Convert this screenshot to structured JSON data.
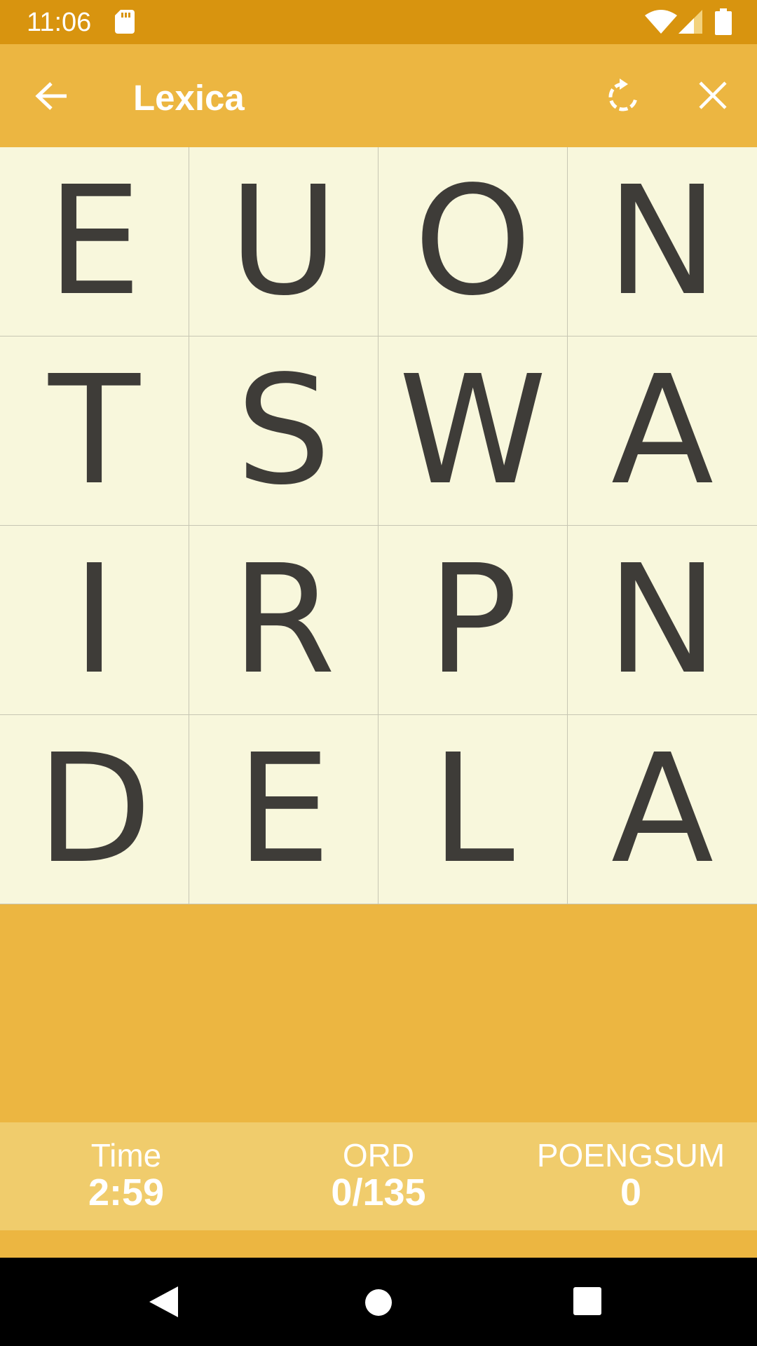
{
  "status_bar": {
    "time": "11:06",
    "icons": [
      "sd-card-icon",
      "wifi-icon",
      "cell-signal-icon",
      "battery-icon"
    ]
  },
  "app_bar": {
    "title": "Lexica",
    "icons": [
      "back-arrow-icon",
      "restart-icon",
      "close-icon"
    ]
  },
  "board": {
    "letters": [
      "E",
      "U",
      "O",
      "N",
      "T",
      "S",
      "W",
      "A",
      "I",
      "R",
      "P",
      "N",
      "D",
      "E",
      "L",
      "A"
    ]
  },
  "stats": {
    "time_label": "Time",
    "time_value": "2:59",
    "words_label": "ORD",
    "words_value": "0/135",
    "score_label": "POENGSUM",
    "score_value": "0"
  },
  "colors": {
    "status_bar": "#d8940f",
    "app_bar": "#ecb641",
    "tile": "#f8f7dc",
    "letter": "#3e3c38",
    "stats_bar": "#f0cc6c"
  },
  "nav_bar": {
    "icons": [
      "nav-back-icon",
      "nav-home-icon",
      "nav-recents-icon"
    ]
  }
}
